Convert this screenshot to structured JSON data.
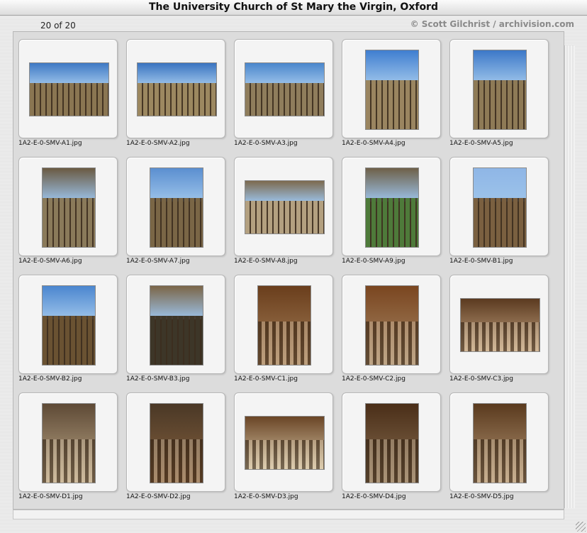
{
  "window": {
    "title": "The University Church of St Mary the Virgin, Oxford"
  },
  "header": {
    "count": "20 of 20",
    "credit": "© Scott Gilchrist / archivision.com"
  },
  "thumbnails": [
    {
      "file": "1A2-E-0-SMV-A1.jpg",
      "orientation": "landscape",
      "scene": "exterior",
      "palette": {
        "top": "#3f79c4",
        "bottom": "#8a7652"
      }
    },
    {
      "file": "1A2-E-0-SMV-A2.jpg",
      "orientation": "landscape",
      "scene": "exterior",
      "palette": {
        "top": "#3a74c0",
        "bottom": "#9c8860"
      }
    },
    {
      "file": "1A2-E-0-SMV-A3.jpg",
      "orientation": "landscape",
      "scene": "exterior",
      "palette": {
        "top": "#4a86cc",
        "bottom": "#8f7d5c"
      }
    },
    {
      "file": "1A2-E-0-SMV-A4.jpg",
      "orientation": "portrait",
      "scene": "exterior",
      "palette": {
        "top": "#3f7ed0",
        "bottom": "#9a8560"
      }
    },
    {
      "file": "1A2-E-0-SMV-A5.jpg",
      "orientation": "portrait",
      "scene": "exterior",
      "palette": {
        "top": "#3c78c8",
        "bottom": "#8e7a56"
      }
    },
    {
      "file": "1A2-E-0-SMV-A6.jpg",
      "orientation": "portrait",
      "scene": "exterior",
      "palette": {
        "top": "#6a5a42",
        "bottom": "#8a7a5a"
      }
    },
    {
      "file": "1A2-E-0-SMV-A7.jpg",
      "orientation": "portrait",
      "scene": "exterior",
      "palette": {
        "top": "#5b8fd0",
        "bottom": "#7a6646"
      }
    },
    {
      "file": "1A2-E-0-SMV-A8.jpg",
      "orientation": "landscape",
      "scene": "exterior",
      "palette": {
        "top": "#7c6a4e",
        "bottom": "#b3a080"
      }
    },
    {
      "file": "1A2-E-0-SMV-A9.jpg",
      "orientation": "portrait",
      "scene": "exterior",
      "palette": {
        "top": "#6e6048",
        "bottom": "#4e7a3a"
      }
    },
    {
      "file": "1A2-E-0-SMV-B1.jpg",
      "orientation": "portrait",
      "scene": "exterior",
      "palette": {
        "top": "#8fb6e6",
        "bottom": "#7a6040"
      }
    },
    {
      "file": "1A2-E-0-SMV-B2.jpg",
      "orientation": "portrait",
      "scene": "exterior",
      "palette": {
        "top": "#4b86cf",
        "bottom": "#6a5232"
      }
    },
    {
      "file": "1A2-E-0-SMV-B3.jpg",
      "orientation": "portrait",
      "scene": "exterior",
      "palette": {
        "top": "#7b6547",
        "bottom": "#3d3628"
      }
    },
    {
      "file": "1A2-E-0-SMV-C1.jpg",
      "orientation": "portrait",
      "scene": "interior",
      "palette": {
        "top": "#6a3e1c",
        "bottom": "#a7815a"
      }
    },
    {
      "file": "1A2-E-0-SMV-C2.jpg",
      "orientation": "portrait",
      "scene": "interior",
      "palette": {
        "top": "#7a4620",
        "bottom": "#a88a68"
      }
    },
    {
      "file": "1A2-E-0-SMV-C3.jpg",
      "orientation": "landscape",
      "scene": "interior",
      "palette": {
        "top": "#5b3a20",
        "bottom": "#c8a884"
      }
    },
    {
      "file": "1A2-E-0-SMV-D1.jpg",
      "orientation": "portrait",
      "scene": "interior",
      "palette": {
        "top": "#5e4a36",
        "bottom": "#c2ad8c"
      }
    },
    {
      "file": "1A2-E-0-SMV-D2.jpg",
      "orientation": "portrait",
      "scene": "interior",
      "palette": {
        "top": "#4a3826",
        "bottom": "#8a6440"
      }
    },
    {
      "file": "1A2-E-0-SMV-D3.jpg",
      "orientation": "landscape",
      "scene": "interior",
      "palette": {
        "top": "#6a4526",
        "bottom": "#d8c8a8"
      }
    },
    {
      "file": "1A2-E-0-SMV-D4.jpg",
      "orientation": "portrait",
      "scene": "interior",
      "palette": {
        "top": "#4a2e18",
        "bottom": "#8a7052"
      }
    },
    {
      "file": "1A2-E-0-SMV-D5.jpg",
      "orientation": "portrait",
      "scene": "interior",
      "palette": {
        "top": "#5a3a1e",
        "bottom": "#b89a78"
      }
    }
  ]
}
